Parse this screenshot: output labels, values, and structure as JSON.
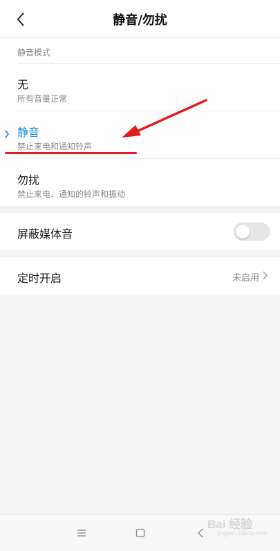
{
  "header": {
    "title": "静音/勿扰"
  },
  "silent_mode": {
    "section_label": "静音模式",
    "options": [
      {
        "title": "无",
        "subtitle": "所有音量正常",
        "selected": false
      },
      {
        "title": "静音",
        "subtitle": "禁止来电和通知铃声",
        "selected": true
      },
      {
        "title": "勿扰",
        "subtitle": "禁止来电、通知的铃声和振动",
        "selected": false
      }
    ]
  },
  "media_mute": {
    "label": "屏蔽媒体音",
    "enabled": false
  },
  "schedule": {
    "label": "定时开启",
    "status": "未启用"
  },
  "watermark": {
    "text": "Bai 经验",
    "url": "jingyan.baidu.com"
  },
  "colors": {
    "accent": "#1e8ee0",
    "annotation": "#e21d1d"
  },
  "icons": {
    "back": "back-arrow-icon",
    "selected": "chevron-right-icon",
    "menu": "menu-icon",
    "home": "square-home-icon",
    "nav_back": "back-triangle-icon"
  }
}
